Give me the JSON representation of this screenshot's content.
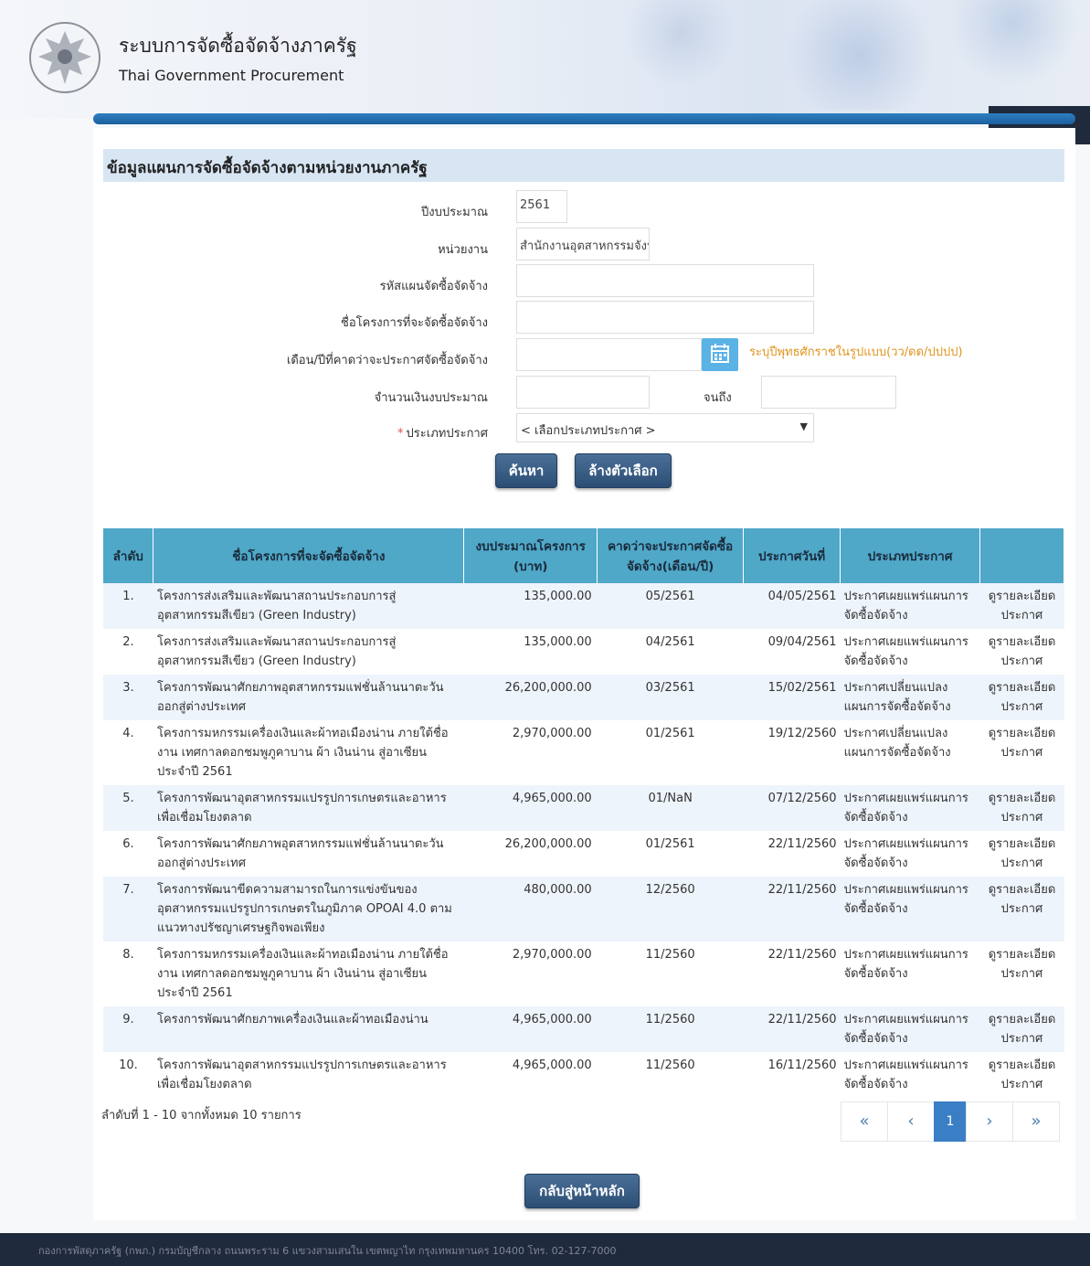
{
  "header": {
    "title": "ระบบการจัดซื้อจัดจ้างภาครัฐ",
    "subtitle": "Thai Government Procurement"
  },
  "section_title": "ข้อมูลแผนการจัดซื้อจัดจ้างตามหน่วยงานภาครัฐ",
  "form": {
    "fiscal_year_label": "ปีงบประมาณ",
    "fiscal_year_value": "2561",
    "agency_label": "หน่วยงาน",
    "agency_value": "สำนักงานอุตสาหกรรมจังห",
    "plan_code_label": "รหัสแผนจัดซื้อจัดจ้าง",
    "plan_code_value": "",
    "project_name_label": "ชื่อโครงการที่จะจัดซื้อจัดจ้าง",
    "project_name_value": "",
    "expected_month_label": "เดือน/ปีที่คาดว่าจะประกาศจัดซื้อจัดจ้าง",
    "expected_month_value": "",
    "date_hint": "ระบุปีพุทธศักราชในรูปแบบ(วว/ดด/ปปปป)",
    "budget_label": "จำนวนเงินงบประมาณ",
    "budget_from_value": "",
    "budget_to_label": "จนถึง",
    "budget_to_value": "",
    "announce_type_label": "ประเภทประกาศ",
    "announce_type_selected": "< เลือกประเภทประกาศ >"
  },
  "buttons": {
    "search": "ค้นหา",
    "clear": "ล้างตัวเลือก",
    "back_home": "กลับสู่หน้าหลัก"
  },
  "table": {
    "headers": [
      "ลำดับ",
      "ชื่อโครงการที่จะจัดซื้อจัดจ้าง",
      "งบประมาณโครงการ (บาท)",
      "คาดว่าจะประกาศจัดซื้อจัดจ้าง(เดือน/ปี)",
      "ประกาศวันที่",
      "ประเภทประกาศ",
      ""
    ],
    "rows": [
      {
        "no": "1.",
        "name": "โครงการส่งเสริมและพัฒนาสถานประกอบการสู่อุตสาหกรรมสีเขียว (Green Industry)",
        "budget": "135,000.00",
        "month": "05/2561",
        "date": "04/05/2561",
        "type": "ประกาศเผยแพร่แผนการจัดซื้อจัดจ้าง",
        "link": "ดูรายละเอียดประกาศ"
      },
      {
        "no": "2.",
        "name": "โครงการส่งเสริมและพัฒนาสถานประกอบการสู่อุตสาหกรรมสีเขียว (Green Industry)",
        "budget": "135,000.00",
        "month": "04/2561",
        "date": "09/04/2561",
        "type": "ประกาศเผยแพร่แผนการจัดซื้อจัดจ้าง",
        "link": "ดูรายละเอียดประกาศ"
      },
      {
        "no": "3.",
        "name": "โครงการพัฒนาศักยภาพอุตสาหกรรมแฟชั่นล้านนาตะวันออกสู่ต่างประเทศ",
        "budget": "26,200,000.00",
        "month": "03/2561",
        "date": "15/02/2561",
        "type": "ประกาศเปลี่ยนแปลงแผนการจัดซื้อจัดจ้าง",
        "link": "ดูรายละเอียดประกาศ"
      },
      {
        "no": "4.",
        "name": "โครงการมหกรรมเครื่องเงินและผ้าทอเมืองน่าน ภายใต้ชื่องาน เทศกาลดอกชมพูภูคาบาน ผ้า เงินน่าน สู่อาเซียน ประจำปี 2561",
        "budget": "2,970,000.00",
        "month": "01/2561",
        "date": "19/12/2560",
        "type": "ประกาศเปลี่ยนแปลงแผนการจัดซื้อจัดจ้าง",
        "link": "ดูรายละเอียดประกาศ"
      },
      {
        "no": "5.",
        "name": "โครงการพัฒนาอุตสาหกรรมแปรรูปการเกษตรและอาหารเพื่อเชื่อมโยงตลาด",
        "budget": "4,965,000.00",
        "month": "01/NaN",
        "date": "07/12/2560",
        "type": "ประกาศเผยแพร่แผนการจัดซื้อจัดจ้าง",
        "link": "ดูรายละเอียดประกาศ"
      },
      {
        "no": "6.",
        "name": "โครงการพัฒนาศักยภาพอุตสาหกรรมแฟชั่นล้านนาตะวันออกสู่ต่างประเทศ",
        "budget": "26,200,000.00",
        "month": "01/2561",
        "date": "22/11/2560",
        "type": "ประกาศเผยแพร่แผนการจัดซื้อจัดจ้าง",
        "link": "ดูรายละเอียดประกาศ"
      },
      {
        "no": "7.",
        "name": "โครงการพัฒนาขีดความสามารถในการแข่งขันของอุตสาหกรรมแปรรูปการเกษตรในภูมิภาค OPOAI 4.0 ตามแนวทางปรัชญาเศรษฐกิจพอเพียง",
        "budget": "480,000.00",
        "month": "12/2560",
        "date": "22/11/2560",
        "type": "ประกาศเผยแพร่แผนการจัดซื้อจัดจ้าง",
        "link": "ดูรายละเอียดประกาศ"
      },
      {
        "no": "8.",
        "name": "โครงการมหกรรมเครื่องเงินและผ้าทอเมืองน่าน ภายใต้ชื่องาน เทศกาลดอกชมพูภูคาบาน ผ้า เงินน่าน สู่อาเซียน ประจำปี 2561",
        "budget": "2,970,000.00",
        "month": "11/2560",
        "date": "22/11/2560",
        "type": "ประกาศเผยแพร่แผนการจัดซื้อจัดจ้าง",
        "link": "ดูรายละเอียดประกาศ"
      },
      {
        "no": "9.",
        "name": "โครงการพัฒนาศักยภาพเครื่องเงินและผ้าทอเมืองน่าน",
        "budget": "4,965,000.00",
        "month": "11/2560",
        "date": "22/11/2560",
        "type": "ประกาศเผยแพร่แผนการจัดซื้อจัดจ้าง",
        "link": "ดูรายละเอียดประกาศ"
      },
      {
        "no": "10.",
        "name": "โครงการพัฒนาอุตสาหกรรมแปรรูปการเกษตรและอาหารเพื่อเชื่อมโยงตลาด",
        "budget": "4,965,000.00",
        "month": "11/2560",
        "date": "16/11/2560",
        "type": "ประกาศเผยแพร่แผนการจัดซื้อจัดจ้าง",
        "link": "ดูรายละเอียดประกาศ"
      }
    ]
  },
  "summary": "ลำดับที่ 1 - 10 จากทั้งหมด 10 รายการ",
  "pagination": {
    "first": "«",
    "prev": "‹",
    "current": "1",
    "next": "›",
    "last": "»"
  },
  "footer": "กองการพัสดุภาครัฐ (กพภ.) กรมบัญชีกลาง ถนนพระราม 6 แขวงสามเสนใน เขตพญาไท กรุงเทพมหานคร 10400 โทร. 02-127-7000",
  "colors": {
    "header_bar": "#1b5f9e",
    "table_header": "#4fa8c8",
    "button": "#2c4e74",
    "link": "#3a8ed0",
    "hint": "#e0931d",
    "calendar_button": "#5bb2e5",
    "footer_bg": "#1f2a3c"
  },
  "icons": {
    "logo": "garuda-emblem-icon",
    "calendar": "calendar-icon",
    "select_caret": "caret-down-icon"
  }
}
